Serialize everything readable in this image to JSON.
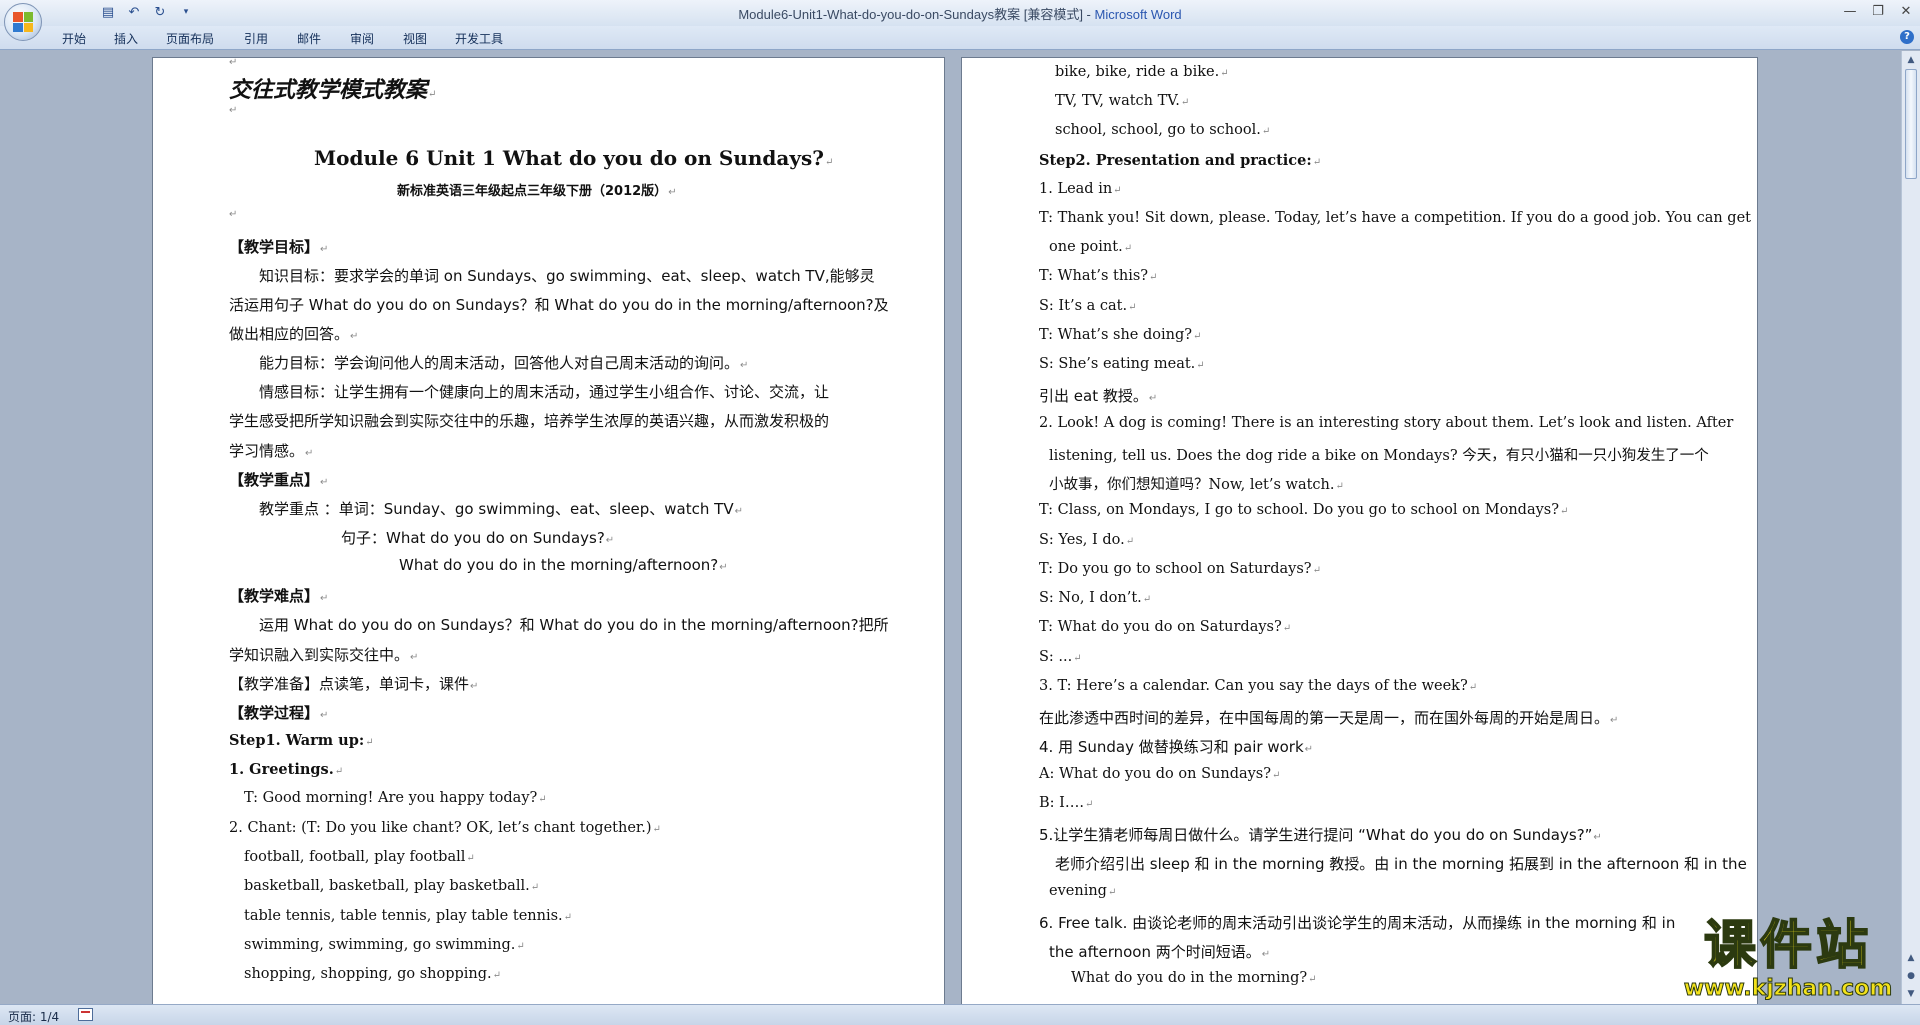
{
  "window": {
    "title": "Module6-Unit1-What-do-you-do-on-Sundays教案 [兼容模式] - ",
    "app": "Microsoft Word"
  },
  "ribbon": {
    "tabs": [
      "开始",
      "插入",
      "页面布局",
      "引用",
      "邮件",
      "审阅",
      "视图",
      "开发工具"
    ]
  },
  "status": {
    "page": "页面: 1/4"
  },
  "watermark": {
    "name": "课件站",
    "url": "www.kjzhan.com"
  },
  "left_page": {
    "lines": [
      "交往式教学模式教案",
      "Module 6 Unit 1 What do you do on Sundays?",
      "新标准英语三年级起点三年级下册（2012版）",
      "【教学目标】",
      "知识目标：要求学会的单词 on Sundays、go swimming、eat、sleep、watch TV,能够灵",
      "活运用句子 What do you do on Sundays？和 What do you do in the morning/afternoon?及",
      "做出相应的回答。",
      "能力目标：学会询问他人的周末活动，回答他人对自己周末活动的询问。",
      "情感目标：让学生拥有一个健康向上的周末活动，通过学生小组合作、讨论、交流，让",
      "学生感受把所学知识融会到实际交往中的乐趣，培养学生浓厚的英语兴趣，从而激发积极的",
      "学习情感。",
      "【教学重点】",
      "教学重点 ：单词：Sunday、go swimming、eat、sleep、watch TV",
      "句子：What do you do on Sundays?",
      "What do you do in the morning/afternoon?",
      "【教学难点】",
      "运用 What do you do on Sundays？和 What do you do in the morning/afternoon?把所",
      "学知识融入到实际交往中。",
      "【教学准备】点读笔，单词卡，课件",
      "【教学过程】",
      "Step1. Warm up:",
      "1. Greetings.",
      "T: Good morning! Are you happy today?",
      "2. Chant: (T: Do you like chant? OK, let’s chant together.)",
      "football, football, play football",
      "basketball, basketball, play basketball.",
      "table tennis, table tennis, play table tennis.",
      "swimming, swimming, go swimming.",
      "shopping, shopping, go shopping."
    ]
  },
  "right_page": {
    "lines": [
      "bike, bike, ride a bike.",
      "TV, TV, watch TV.",
      "school, school, go to school.",
      "Step2. Presentation and practice:",
      "1. Lead in",
      "T:  Thank you! Sit down, please. Today, let’s have a competition. If you do a good job. You can get",
      "one point.",
      "T: What’s this?",
      "S: It’s a cat.",
      "T: What’s she doing?",
      "S: She’s eating meat.",
      "引出 eat 教授。",
      "2. Look! A dog is coming! There is an interesting story about them. Let’s look and listen. After",
      "listening, tell us. Does the dog ride a bike on Mondays? 今天，有只小猫和一只小狗发生了一个",
      "小故事，你们想知道吗？Now, let’s watch.",
      "T: Class, on Mondays, I go to school. Do you go to school on Mondays?",
      "S: Yes, I do.",
      "T: Do you go to school on Saturdays?",
      "S: No, I don’t.",
      "T: What do you do on Saturdays?",
      "S: ...",
      "3. T: Here’s a calendar. Can you say the days of the week?",
      "在此渗透中西时间的差异，在中国每周的第一天是周一，而在国外每周的开始是周日。",
      "4. 用 Sunday 做替换练习和 pair work",
      "A: What do you do on Sundays?",
      "B: I….",
      "5.让学生猜老师每周日做什么。请学生进行提问 “What do you do on Sundays?”",
      "老师介绍引出 sleep 和 in the morning 教授。由 in the morning 拓展到 in the afternoon 和 in the",
      "evening",
      "6. Free talk. 由谈论老师的周末活动引出谈论学生的周末活动，从而操练 in the morning 和 in",
      "the afternoon 两个时间短语。",
      "What do you do in the morning?"
    ]
  }
}
